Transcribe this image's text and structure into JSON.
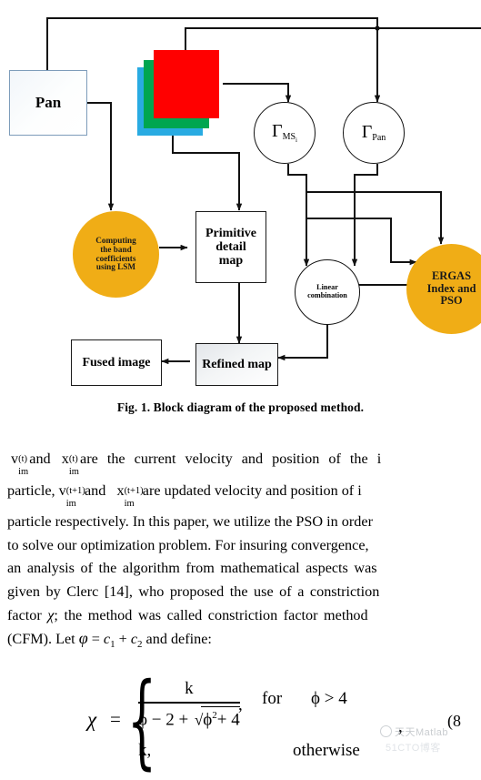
{
  "figure": {
    "caption": "Fig. 1. Block diagram of the proposed method.",
    "colors": {
      "orange": "#f0ad16",
      "red": "#ff0000",
      "green": "#00a650",
      "blue": "#29abe2",
      "pan_border": "#7d9cba",
      "line": "#111111"
    },
    "nodes": {
      "pan": "Pan",
      "ms_stack": "MS image bands",
      "gamma_ms": {
        "symbol": "Γ",
        "subscript": "MS",
        "subsubscript": "i"
      },
      "gamma_pan": {
        "symbol": "Γ",
        "subscript": "Pan"
      },
      "computing_lsm": [
        "Computing",
        "the band",
        "coefficients",
        "using LSM"
      ],
      "primitive_detail": [
        "Primitive",
        "detail",
        "map"
      ],
      "linear_combination": [
        "Linear",
        "combination"
      ],
      "ergas_pso": [
        "ERGAS",
        "Index and",
        "PSO"
      ],
      "refined_map": "Refined map",
      "fused_image": "Fused image"
    }
  },
  "body": {
    "lines": [
      {
        "parts": [
          {
            "t": "v",
            "kind": "var"
          },
          {
            "t": "(t)",
            "kind": "sup"
          },
          {
            "t": "im",
            "kind": "sub"
          },
          {
            "t": "and",
            "kind": "text"
          },
          {
            "t": "x",
            "kind": "var"
          },
          {
            "t": "(t)",
            "kind": "sup"
          },
          {
            "t": "im",
            "kind": "sub"
          },
          {
            "t": "are the current velocity and position of the i",
            "kind": "text"
          }
        ]
      },
      {
        "parts": [
          {
            "t": "particle, v",
            "kind": "text"
          },
          {
            "t": "(t+1)",
            "kind": "sup"
          },
          {
            "t": "im",
            "kind": "sub"
          },
          {
            "t": "and",
            "kind": "text"
          },
          {
            "t": "x",
            "kind": "var"
          },
          {
            "t": "(t+1)",
            "kind": "sup"
          },
          {
            "t": "im",
            "kind": "sub"
          },
          {
            "t": "are updated velocity and position of i",
            "kind": "text"
          }
        ]
      }
    ],
    "line3": "particle respectively. In this paper, we utilize the PSO in order",
    "line4": "to solve our optimization problem. For insuring convergence,",
    "line5": "an analysis of the algorithm from mathematical aspects was",
    "line6": "given by Clerc [14], who proposed the use of a constriction",
    "line7_a": "factor ",
    "line7_chi": "χ",
    "line7_b": "; the method was called constriction factor method",
    "line8_a": "(CFM). Let ",
    "line8_phi": "φ",
    "line8_eq": " = ",
    "line8_c1": "c",
    "line8_c1sub": "1",
    "line8_plus": " + ",
    "line8_c2": "c",
    "line8_c2sub": "2",
    "line8_tail": " and define:"
  },
  "equation": {
    "chi": "χ",
    "equals": "=",
    "numerator": "k",
    "denominator_a": "ϕ − 2 +",
    "denominator_rad": "ϕ",
    "denominator_radsup": "2",
    "denominator_radtail": "+ 4",
    "comma_inline": ",",
    "for": "for",
    "condition": "ϕ > 4",
    "second_case": "k,",
    "otherwise": "otherwise",
    "trailing_comma": ",",
    "number": "(8"
  },
  "watermark": {
    "line1": "天天Matlab",
    "line2": "51CTO博客"
  }
}
